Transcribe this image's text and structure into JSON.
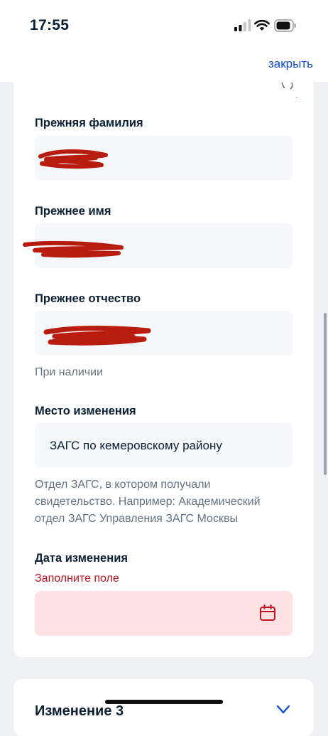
{
  "status_bar": {
    "time": "17:55"
  },
  "header": {
    "close_label": "закрыть"
  },
  "form": {
    "previous_surname": {
      "label": "Прежняя фамилия",
      "value": ""
    },
    "previous_name": {
      "label": "Прежнее имя",
      "value": ""
    },
    "previous_patronymic": {
      "label": "Прежнее отчество",
      "value": "",
      "hint": "При наличии"
    },
    "place_of_change": {
      "label": "Место изменения",
      "value": "ЗАГС по кемеровскому району",
      "hint_lines": [
        "Отдел ЗАГС, в котором получали",
        "свидетельство. Например: Академический",
        "отдел ЗАГС Управления ЗАГС Москвы"
      ]
    },
    "date_of_change": {
      "label": "Дата изменения",
      "error": "Заполните поле",
      "value": ""
    }
  },
  "next_section": {
    "title": "Изменение 3"
  },
  "colors": {
    "accent": "#0d4cd3",
    "error": "#c1121f",
    "error_bg": "#fde1e3",
    "input_bg": "#f5f7fa",
    "redaction": "#b81c0e"
  },
  "icons": [
    "signal-icon",
    "wifi-icon",
    "battery-icon",
    "calendar-icon",
    "collapse-icon"
  ]
}
